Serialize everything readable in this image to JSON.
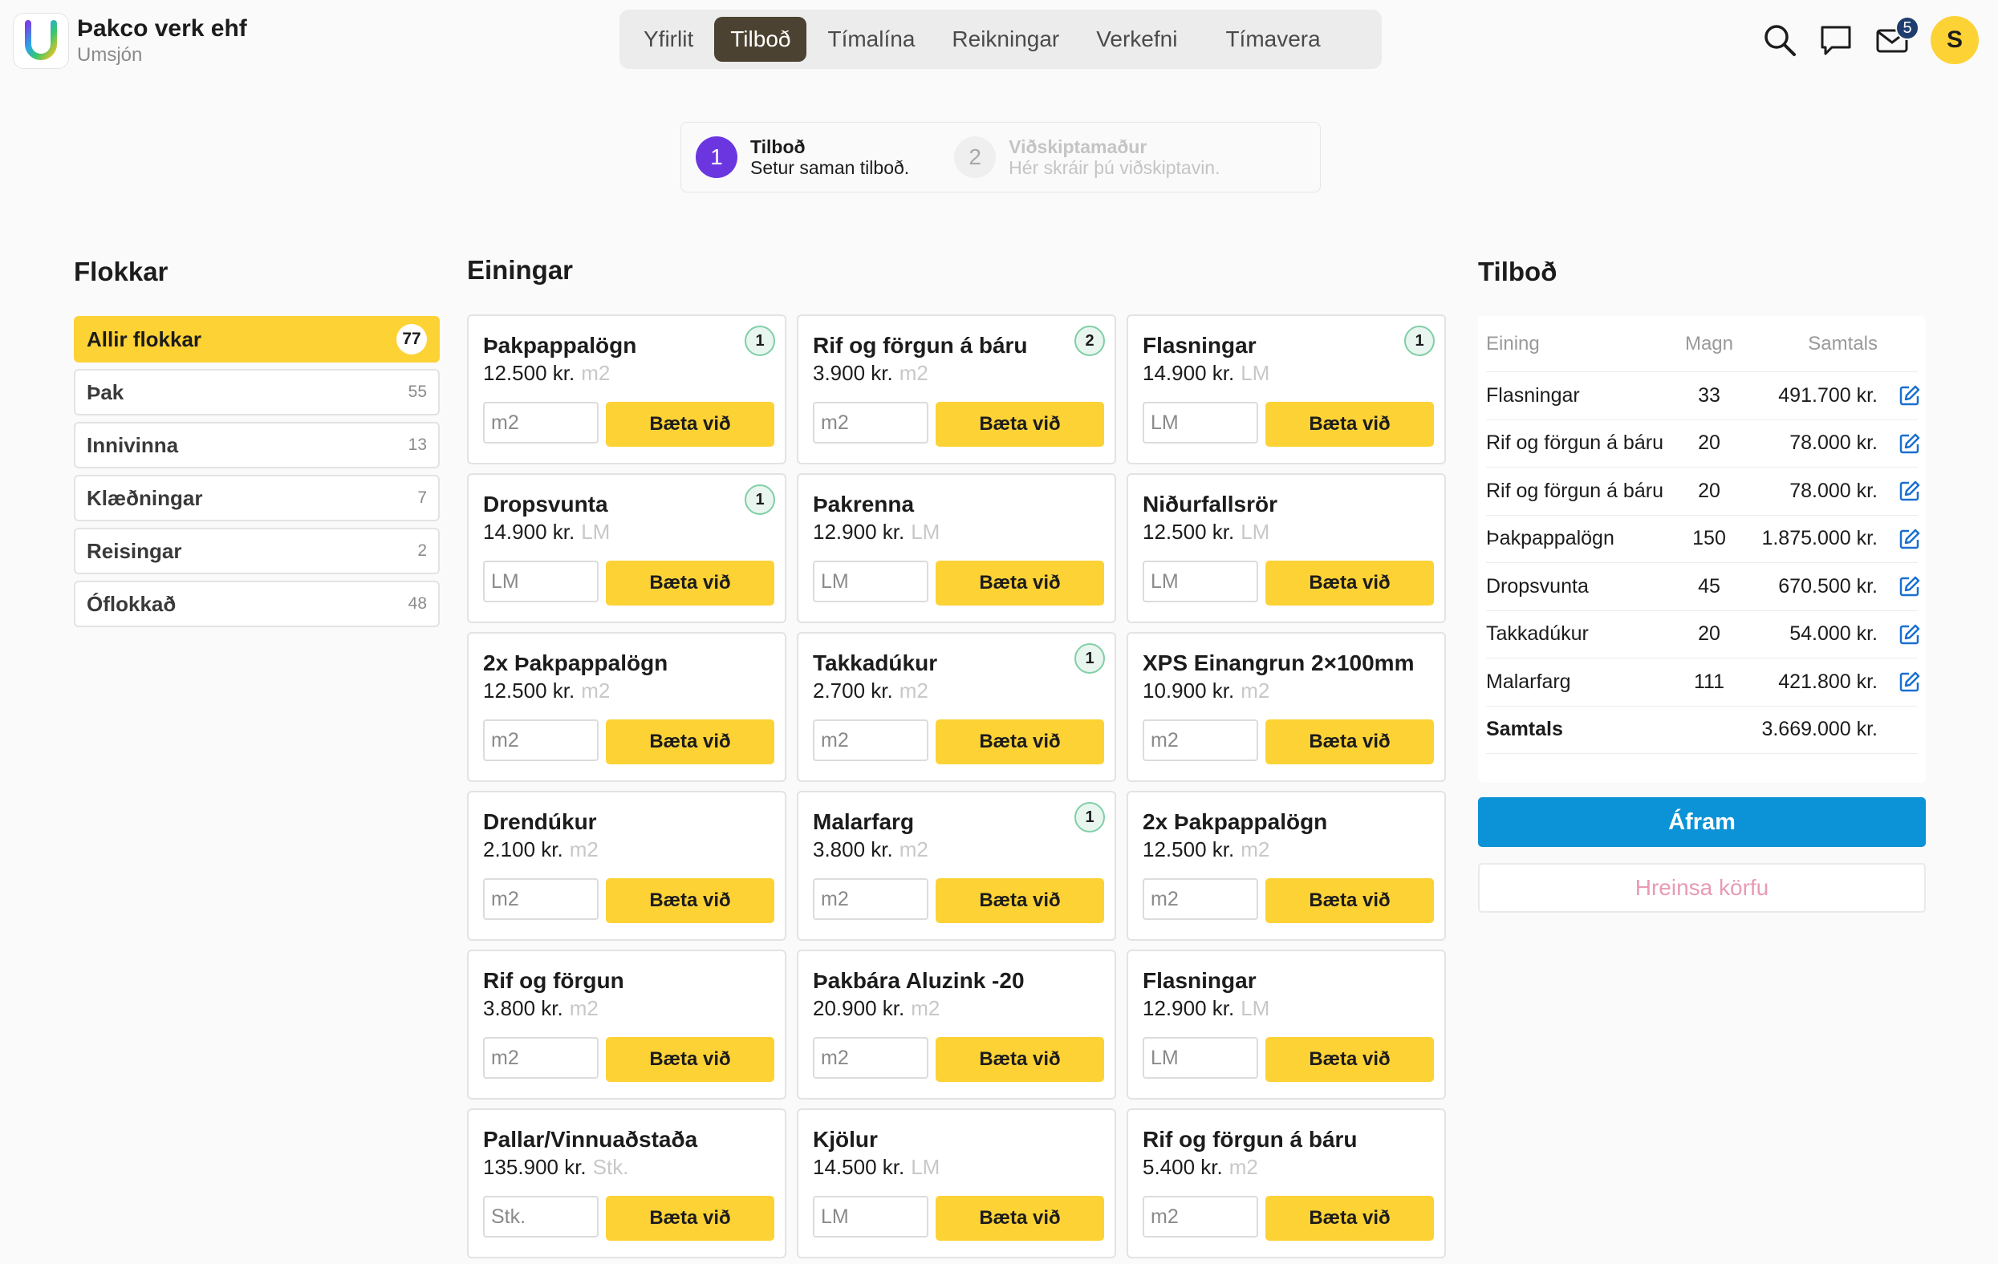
{
  "brand": {
    "name": "Þakco verk ehf",
    "subtitle": "Umsjón"
  },
  "nav": {
    "tabs": [
      {
        "label": "Yfirlit",
        "active": false
      },
      {
        "label": "Tilboð",
        "active": true
      },
      {
        "label": "Tímalína",
        "active": false
      },
      {
        "label": "Reikningar",
        "active": false
      },
      {
        "label": "Verkefni",
        "active": false
      },
      {
        "label": "Tímavera",
        "active": false
      }
    ]
  },
  "header_icons": {
    "search": "search-icon",
    "chat": "chat-icon",
    "mail": "mail-icon",
    "mail_badge": "5",
    "avatar_letter": "S"
  },
  "stepper": {
    "steps": [
      {
        "num": "1",
        "title": "Tilboð",
        "desc": "Setur saman tilboð.",
        "active": true
      },
      {
        "num": "2",
        "title": "Viðskiptamaður",
        "desc": "Hér skráir þú viðskiptavin.",
        "active": false
      }
    ]
  },
  "categories": {
    "title": "Flokkar",
    "items": [
      {
        "label": "Allir flokkar",
        "count": "77",
        "active": true
      },
      {
        "label": "Þak",
        "count": "55",
        "active": false
      },
      {
        "label": "Innivinna",
        "count": "13",
        "active": false
      },
      {
        "label": "Klæðningar",
        "count": "7",
        "active": false
      },
      {
        "label": "Reisingar",
        "count": "2",
        "active": false
      },
      {
        "label": "Óflokkað",
        "count": "48",
        "active": false
      }
    ]
  },
  "units": {
    "title": "Einingar",
    "add_label": "Bæta við",
    "items": [
      {
        "name": "Þakpappalögn",
        "price": "12.500 kr.",
        "unit": "m2",
        "badge": "1"
      },
      {
        "name": "Rif og förgun á báru",
        "price": "3.900 kr.",
        "unit": "m2",
        "badge": "2"
      },
      {
        "name": "Flasningar",
        "price": "14.900 kr.",
        "unit": "LM",
        "badge": "1"
      },
      {
        "name": "Dropsvunta",
        "price": "14.900 kr.",
        "unit": "LM",
        "badge": "1"
      },
      {
        "name": "Þakrenna",
        "price": "12.900 kr.",
        "unit": "LM",
        "badge": ""
      },
      {
        "name": "Niðurfallsrör",
        "price": "12.500 kr.",
        "unit": "LM",
        "badge": ""
      },
      {
        "name": "2x Þakpappalögn",
        "price": "12.500 kr.",
        "unit": "m2",
        "badge": ""
      },
      {
        "name": "Takkadúkur",
        "price": "2.700 kr.",
        "unit": "m2",
        "badge": "1"
      },
      {
        "name": "XPS Einangrun 2×100mm",
        "price": "10.900 kr.",
        "unit": "m2",
        "badge": ""
      },
      {
        "name": "Drendúkur",
        "price": "2.100 kr.",
        "unit": "m2",
        "badge": ""
      },
      {
        "name": "Malarfarg",
        "price": "3.800 kr.",
        "unit": "m2",
        "badge": "1"
      },
      {
        "name": "2x Þakpappalögn",
        "price": "12.500 kr.",
        "unit": "m2",
        "badge": ""
      },
      {
        "name": "Rif og förgun",
        "price": "3.800 kr.",
        "unit": "m2",
        "badge": ""
      },
      {
        "name": "Þakbára Aluzink -20",
        "price": "20.900 kr.",
        "unit": "m2",
        "badge": ""
      },
      {
        "name": "Flasningar",
        "price": "12.900 kr.",
        "unit": "LM",
        "badge": ""
      },
      {
        "name": "Pallar/Vinnuaðstaða",
        "price": "135.900 kr.",
        "unit": "Stk.",
        "badge": ""
      },
      {
        "name": "Kjölur",
        "price": "14.500 kr.",
        "unit": "LM",
        "badge": ""
      },
      {
        "name": "Rif og förgun á báru",
        "price": "5.400 kr.",
        "unit": "m2",
        "badge": ""
      }
    ]
  },
  "quote": {
    "title": "Tilboð",
    "headers": {
      "unit": "Eining",
      "qty": "Magn",
      "total": "Samtals"
    },
    "rows": [
      {
        "unit": "Flasningar",
        "qty": "33",
        "total": "491.700 kr."
      },
      {
        "unit": "Rif og förgun á báru",
        "qty": "20",
        "total": "78.000 kr."
      },
      {
        "unit": "Rif og förgun á báru",
        "qty": "20",
        "total": "78.000 kr."
      },
      {
        "unit": "Þakpappalögn",
        "qty": "150",
        "total": "1.875.000 kr."
      },
      {
        "unit": "Dropsvunta",
        "qty": "45",
        "total": "670.500 kr."
      },
      {
        "unit": "Takkadúkur",
        "qty": "20",
        "total": "54.000 kr."
      },
      {
        "unit": "Malarfarg",
        "qty": "111",
        "total": "421.800 kr."
      }
    ],
    "total_label": "Samtals",
    "total_value": "3.669.000 kr.",
    "continue_label": "Áfram",
    "clear_label": "Hreinsa körfu"
  },
  "colors": {
    "accent": "#fdd235",
    "nav_active": "#4b4231",
    "step_active": "#6b36e0",
    "primary_button": "#0c92d6",
    "clear_text": "#e89ab5"
  }
}
